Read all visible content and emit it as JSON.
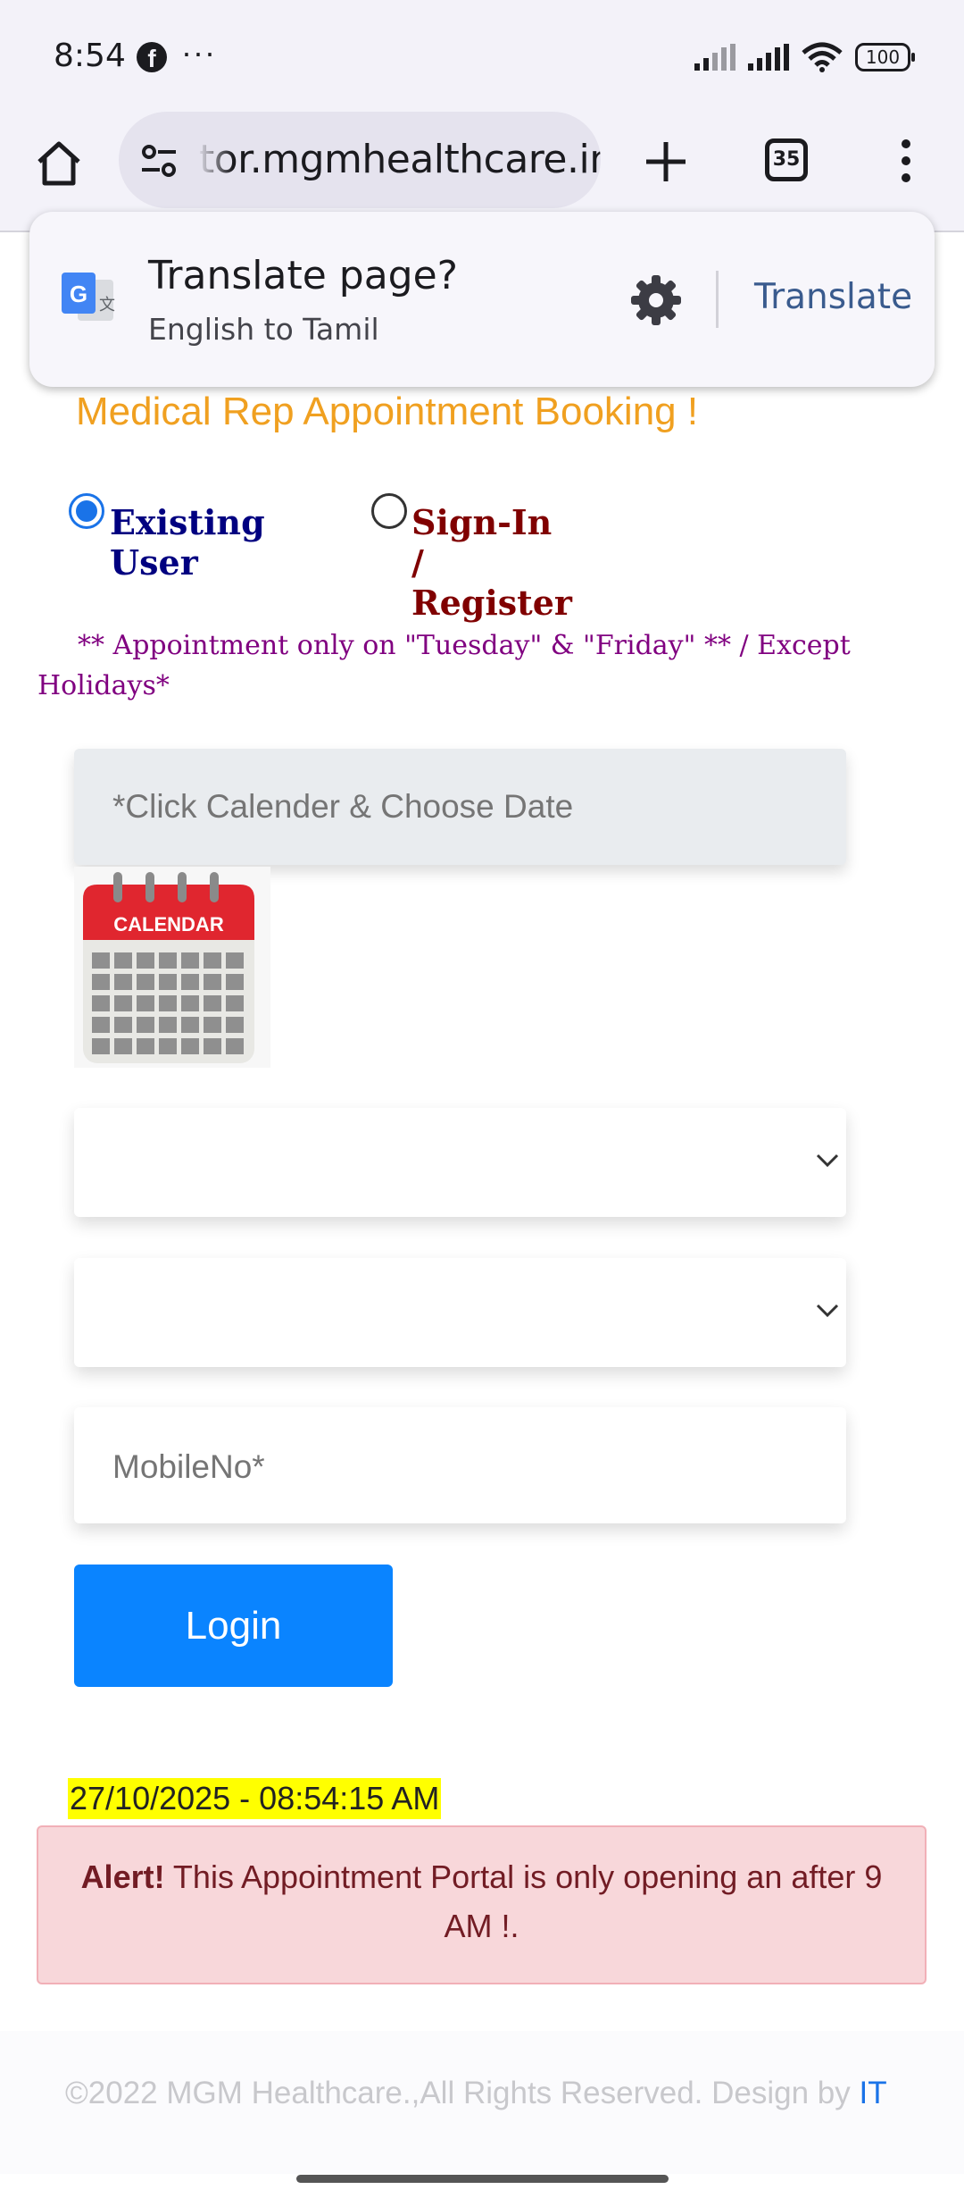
{
  "status_bar": {
    "time": "8:54",
    "notification_icon": "facebook-icon",
    "more": "···",
    "battery": "100"
  },
  "browser": {
    "url": "tor.mgmhealthcare.in",
    "tab_count": "35"
  },
  "translate_bar": {
    "title": "Translate page?",
    "subtitle": "English to Tamil",
    "action": "Translate"
  },
  "page": {
    "heading": "Medical Rep Appointment Booking !",
    "radio_existing": "Existing User",
    "radio_register": "Sign-In / Register",
    "notice": "** Appointment only on \"Tuesday\" & \"Friday\" ** / Except Holidays*",
    "date_placeholder": "*Click Calender & Choose Date",
    "calendar_label": "CALENDAR",
    "select1_value": "",
    "select2_value": "",
    "mobile_placeholder": "MobileNo*",
    "login_label": "Login",
    "timestamp": "27/10/2025 - 08:54:15 AM",
    "alert_strong": "Alert!",
    "alert_text": " This Appointment Portal is only opening an after 9 AM !."
  },
  "footer": {
    "text": "©2022 MGM Healthcare.,All Rights Reserved. Design by ",
    "link": "IT"
  },
  "colors": {
    "heading": "#f0a020",
    "existing_user": "#000080",
    "register": "#800000",
    "notice": "#800080",
    "login_button": "#0a84ff",
    "alert_bg": "#f8d7da",
    "timestamp_highlight": "#ffff00"
  }
}
